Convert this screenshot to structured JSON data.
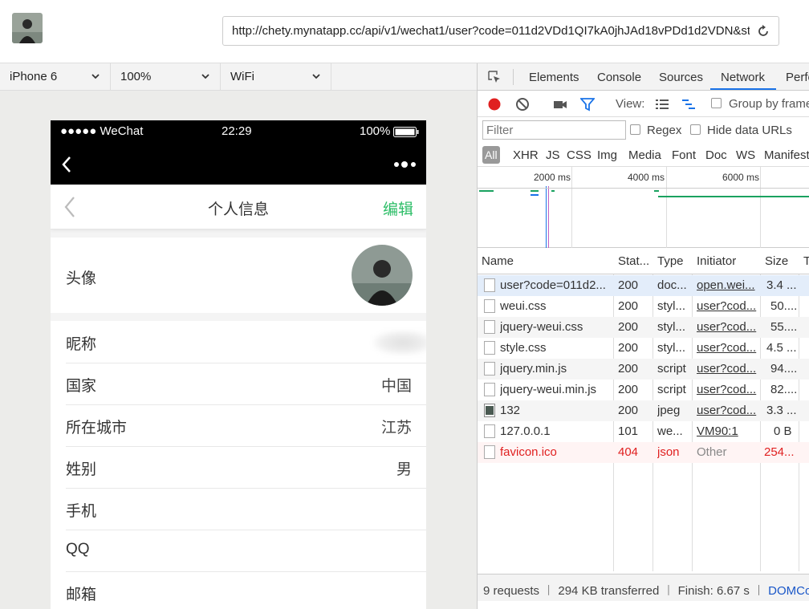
{
  "browser": {
    "url": "http://chety.mynatapp.cc/api/v1/wechat1/user?code=011d2VDd1QI7kA0jhJAd18vPDd1d2VDN&st"
  },
  "device_toolbar": {
    "device": "iPhone 6",
    "zoom": "100%",
    "network": "WiFi"
  },
  "phone": {
    "status": {
      "carrier": "●●●●● WeChat",
      "time": "22:29",
      "battery": "100%"
    },
    "page": {
      "title": "个人信息",
      "edit": "编辑"
    },
    "avatar_label": "头像",
    "fields": [
      {
        "label": "昵称",
        "value": ""
      },
      {
        "label": "国家",
        "value": "中国"
      },
      {
        "label": "所在城市",
        "value": "江苏"
      },
      {
        "label": "姓别",
        "value": "男"
      },
      {
        "label": "手机",
        "value": ""
      },
      {
        "label": "QQ",
        "value": ""
      },
      {
        "label": "邮箱",
        "value": ""
      }
    ]
  },
  "devtools": {
    "tabs": [
      "Elements",
      "Console",
      "Sources",
      "Network",
      "Perfo"
    ],
    "active_tab": "Network",
    "toolbar": {
      "view_label": "View:",
      "group_by_frame": "Group by frame"
    },
    "filter": {
      "placeholder": "Filter",
      "regex": "Regex",
      "hide_data_urls": "Hide data URLs"
    },
    "types": [
      "All",
      "XHR",
      "JS",
      "CSS",
      "Img",
      "Media",
      "Font",
      "Doc",
      "WS",
      "Manifest"
    ],
    "timeline_ticks": [
      "2000 ms",
      "4000 ms",
      "6000 ms"
    ],
    "columns": [
      "Name",
      "Stat...",
      "Type",
      "Initiator",
      "Size",
      "T"
    ],
    "rows": [
      {
        "name": "user?code=011d2...",
        "status": "200",
        "type": "doc...",
        "initiator": "open.wei...",
        "size": "3.4 ..."
      },
      {
        "name": "weui.css",
        "status": "200",
        "type": "styl...",
        "initiator": "user?cod...",
        "size": "50...."
      },
      {
        "name": "jquery-weui.css",
        "status": "200",
        "type": "styl...",
        "initiator": "user?cod...",
        "size": "55...."
      },
      {
        "name": "style.css",
        "status": "200",
        "type": "styl...",
        "initiator": "user?cod...",
        "size": "4.5 ..."
      },
      {
        "name": "jquery.min.js",
        "status": "200",
        "type": "script",
        "initiator": "user?cod...",
        "size": "94...."
      },
      {
        "name": "jquery-weui.min.js",
        "status": "200",
        "type": "script",
        "initiator": "user?cod...",
        "size": "82...."
      },
      {
        "name": "132",
        "status": "200",
        "type": "jpeg",
        "initiator": "user?cod...",
        "size": "3.3 ..."
      },
      {
        "name": "127.0.0.1",
        "status": "101",
        "type": "we...",
        "initiator": "VM90:1",
        "size": "0 B"
      },
      {
        "name": "favicon.ico",
        "status": "404",
        "type": "json",
        "initiator": "Other",
        "size": "254..."
      }
    ],
    "status_bar": {
      "summary": "9 requests ︱ 294 KB transferred ︱ Finish: 6.67 s ︱ ",
      "dom": "DOMConten"
    }
  },
  "colors": {
    "accent_green": "#2bbd66",
    "devtools_blue": "#1a73e8",
    "error_red": "#e02020"
  }
}
